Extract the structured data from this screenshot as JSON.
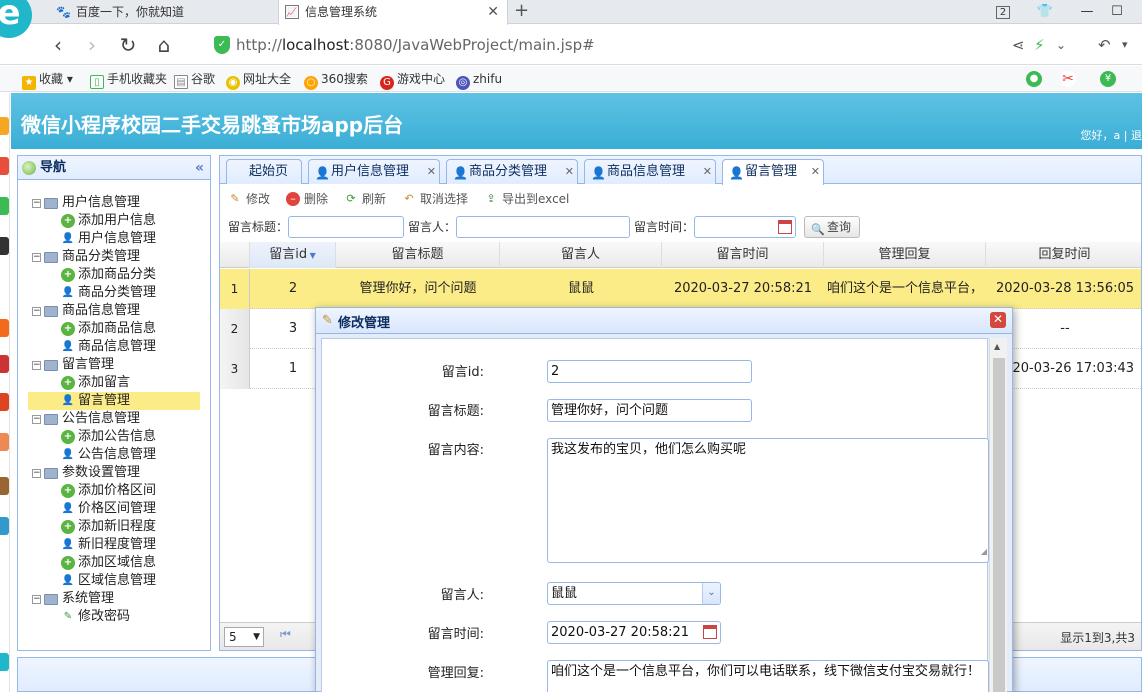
{
  "browser": {
    "tabs": [
      {
        "label": "百度一下，你就知道",
        "icon": "paw-icon"
      },
      {
        "label": "信息管理系统",
        "icon": "chart-icon"
      }
    ],
    "tab_count_badge": "2",
    "url_prefix": "http://",
    "url_host": "localhost",
    "url_rest": ":8080/JavaWebProject/main.jsp#",
    "bookmarks": [
      "收藏",
      "手机收藏夹",
      "谷歌",
      "网址大全",
      "360搜索",
      "游戏中心",
      "zhifu"
    ]
  },
  "app": {
    "title": "微信小程序校园二手交易跳蚤市场app后台",
    "greeting": "您好，a | 退"
  },
  "nav": {
    "title": "导航",
    "tree": [
      {
        "label": "用户信息管理",
        "level": 0
      },
      {
        "label": "添加用户信息",
        "level": 1,
        "icon": "plus"
      },
      {
        "label": "用户信息管理",
        "level": 1,
        "icon": "user"
      },
      {
        "label": "商品分类管理",
        "level": 0
      },
      {
        "label": "添加商品分类",
        "level": 1,
        "icon": "plus"
      },
      {
        "label": "商品分类管理",
        "level": 1,
        "icon": "user"
      },
      {
        "label": "商品信息管理",
        "level": 0
      },
      {
        "label": "添加商品信息",
        "level": 1,
        "icon": "plus"
      },
      {
        "label": "商品信息管理",
        "level": 1,
        "icon": "user"
      },
      {
        "label": "留言管理",
        "level": 0
      },
      {
        "label": "添加留言",
        "level": 1,
        "icon": "plus"
      },
      {
        "label": "留言管理",
        "level": 1,
        "icon": "user",
        "selected": true
      },
      {
        "label": "公告信息管理",
        "level": 0
      },
      {
        "label": "添加公告信息",
        "level": 1,
        "icon": "plus"
      },
      {
        "label": "公告信息管理",
        "level": 1,
        "icon": "user"
      },
      {
        "label": "参数设置管理",
        "level": 0
      },
      {
        "label": "添加价格区间",
        "level": 1,
        "icon": "plus"
      },
      {
        "label": "价格区间管理",
        "level": 1,
        "icon": "user"
      },
      {
        "label": "添加新旧程度",
        "level": 1,
        "icon": "plus"
      },
      {
        "label": "新旧程度管理",
        "level": 1,
        "icon": "user"
      },
      {
        "label": "添加区域信息",
        "level": 1,
        "icon": "plus"
      },
      {
        "label": "区域信息管理",
        "level": 1,
        "icon": "user"
      },
      {
        "label": "系统管理",
        "level": 0
      },
      {
        "label": "修改密码",
        "level": 1,
        "icon": "pen"
      }
    ]
  },
  "tabs": [
    {
      "label": "起始页",
      "closable": false
    },
    {
      "label": "用户信息管理",
      "closable": true
    },
    {
      "label": "商品分类管理",
      "closable": true
    },
    {
      "label": "商品信息管理",
      "closable": true
    },
    {
      "label": "留言管理",
      "closable": true,
      "active": true
    }
  ],
  "toolbar": {
    "edit": "修改",
    "delete": "删除",
    "refresh": "刷新",
    "unselect": "取消选择",
    "export": "导出到excel"
  },
  "search": {
    "title_label": "留言标题：",
    "person_label": "留言人：",
    "time_label": "留言时间：",
    "query_button": "查询"
  },
  "grid": {
    "columns": [
      "留言id",
      "留言标题",
      "留言人",
      "留言时间",
      "管理回复",
      "回复时间"
    ],
    "rows": [
      {
        "rownum": "1",
        "cells": [
          "2",
          "管理你好，问个问题",
          "鼠鼠",
          "2020-03-27 20:58:21",
          "咱们这个是一个信息平台，",
          "2020-03-28 13:56:05"
        ]
      },
      {
        "rownum": "2",
        "cells": [
          "3",
          "",
          "",
          "",
          "",
          "--"
        ]
      },
      {
        "rownum": "3",
        "cells": [
          "1",
          "",
          "",
          "",
          "",
          "2020-03-26 17:03:43"
        ]
      }
    ]
  },
  "pager": {
    "page_size": "5",
    "info": "显示1到3,共3"
  },
  "dialog": {
    "title": "修改管理",
    "fields": {
      "id_label": "留言id:",
      "id_value": "2",
      "title_label": "留言标题:",
      "title_value": "管理你好，问个问题",
      "content_label": "留言内容:",
      "content_value": "我这发布的宝贝，他们怎么购买呢",
      "person_label": "留言人:",
      "person_value": "鼠鼠",
      "time_label": "留言时间:",
      "time_value": "2020-03-27 20:58:21",
      "reply_label": "管理回复:",
      "reply_value": "咱们这个是一个信息平台，你们可以电话联系，线下微信支付宝交易就行！"
    }
  }
}
